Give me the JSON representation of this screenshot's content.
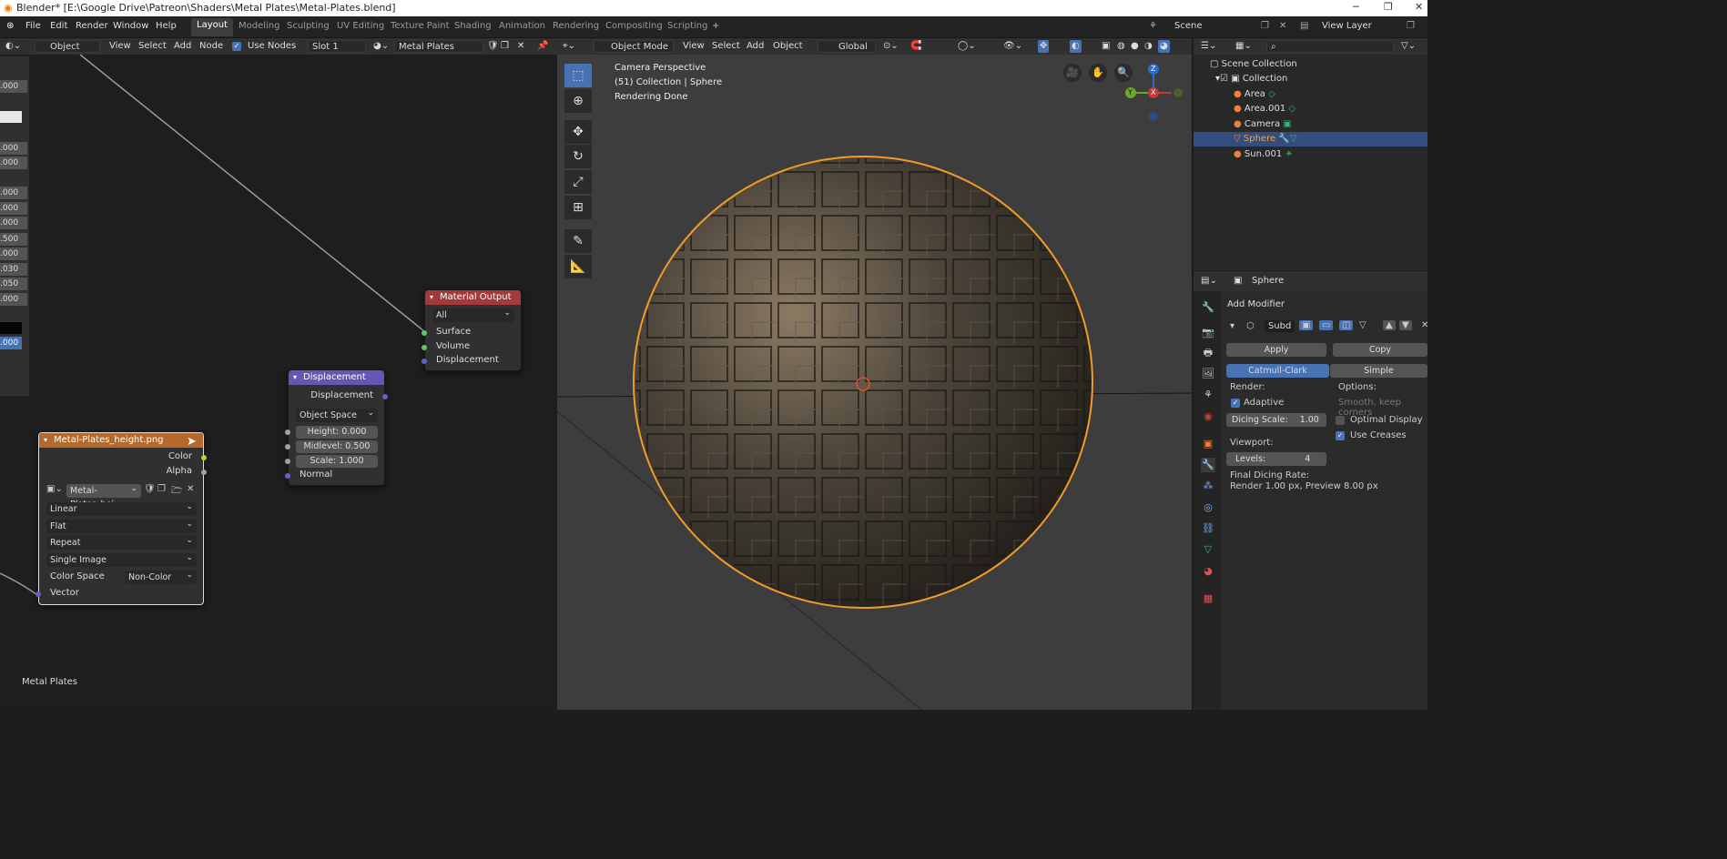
{
  "window": {
    "title": "Blender* [E:\\Google Drive\\Patreon\\Shaders\\Metal Plates\\Metal-Plates.blend]"
  },
  "menu": {
    "items": [
      "File",
      "Edit",
      "Render",
      "Window",
      "Help"
    ]
  },
  "workspaces": [
    "Layout",
    "Modeling",
    "Sculpting",
    "UV Editing",
    "Texture Paint",
    "Shading",
    "Animation",
    "Rendering",
    "Compositing",
    "Scripting"
  ],
  "scene": {
    "label": "Scene",
    "view_layer": "View Layer"
  },
  "node_editor": {
    "header": {
      "object_mode": "Object",
      "view": "View",
      "select": "Select",
      "add": "Add",
      "node": "Node",
      "use_nodes": "Use Nodes",
      "slot": "Slot 1",
      "material": "Metal Plates"
    },
    "left_values": [
      ".000",
      ".000",
      ".000",
      ".000",
      ".000",
      ".000",
      ".500",
      ".000",
      ".030",
      ".050",
      ".000",
      ".000"
    ],
    "footer_label": "Metal Plates",
    "material_output": {
      "title": "Material Output",
      "target": "All",
      "inputs": [
        "Surface",
        "Volume",
        "Displacement"
      ]
    },
    "displacement": {
      "title": "Displacement",
      "output": "Displacement",
      "space": "Object Space",
      "fields": [
        {
          "label": "Height:",
          "value": "0.000"
        },
        {
          "label": "Midlevel:",
          "value": "0.500"
        },
        {
          "label": "Scale:",
          "value": "1.000"
        }
      ],
      "normal": "Normal"
    },
    "image_texture": {
      "title": "Metal-Plates_height.png",
      "outputs": [
        "Color",
        "Alpha"
      ],
      "image_name": "Metal-Plates_hei...",
      "interpolation": "Linear",
      "projection": "Flat",
      "extension": "Repeat",
      "source": "Single Image",
      "color_space_label": "Color Space",
      "color_space": "Non-Color",
      "vector": "Vector"
    }
  },
  "viewport": {
    "header": {
      "mode": "Object Mode",
      "view": "View",
      "select": "Select",
      "add": "Add",
      "object": "Object",
      "orientation": "Global"
    },
    "overlay_text": [
      "Camera Perspective",
      "(51) Collection | Sphere",
      "Rendering Done"
    ],
    "gizmo": {
      "z": "Z",
      "y": "Y",
      "x": "X"
    }
  },
  "outliner": {
    "items": [
      {
        "label": "Scene Collection",
        "indent": 0
      },
      {
        "label": "Collection",
        "indent": 1
      },
      {
        "label": "Area",
        "indent": 2
      },
      {
        "label": "Area.001",
        "indent": 2
      },
      {
        "label": "Camera",
        "indent": 2
      },
      {
        "label": "Sphere",
        "indent": 2,
        "selected": true
      },
      {
        "label": "Sun.001",
        "indent": 2
      }
    ]
  },
  "properties": {
    "object_name": "Sphere",
    "add_modifier": "Add Modifier",
    "modifier_name": "Subd",
    "apply": "Apply",
    "copy": "Copy",
    "catmull": "Catmull-Clark",
    "simple": "Simple",
    "render_label": "Render:",
    "options_label": "Options:",
    "adaptive": "Adaptive",
    "smooth": "Smooth, keep corners",
    "dicing_scale": "Dicing Scale:",
    "dicing_value": "1.00",
    "optimal_display": "Optimal Display",
    "use_creases": "Use Creases",
    "viewport_label": "Viewport:",
    "levels_label": "Levels:",
    "levels_value": "4",
    "final_rate_label": "Final Dicing Rate:",
    "final_rate_value": "Render 1.00 px, Preview 8.00 px"
  },
  "colors": {
    "accent": "#4772b3",
    "material_output_header": "#a33a3a",
    "displacement_header": "#6656b3",
    "image_header": "#b36a2c",
    "selection_orange": "#f29b2a"
  }
}
